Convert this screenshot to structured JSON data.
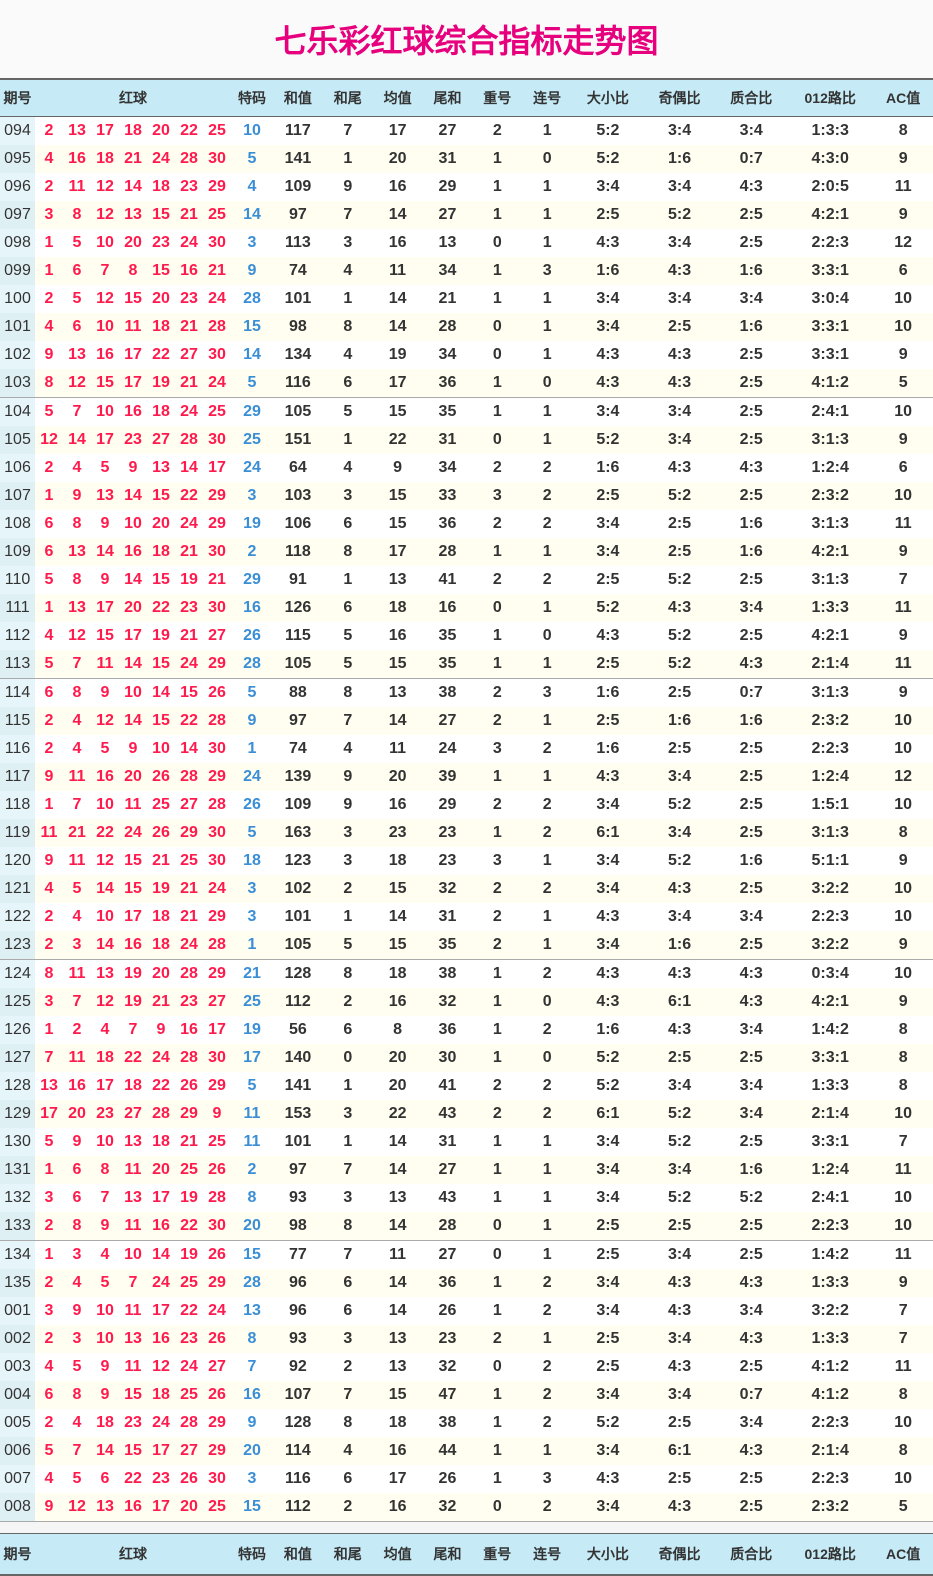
{
  "title": "七乐彩红球综合指标走势图",
  "headers": [
    "期号",
    "红球",
    "特码",
    "和值",
    "和尾",
    "均值",
    "尾和",
    "重号",
    "连号",
    "大小比",
    "奇偶比",
    "质合比",
    "012路比",
    "AC值"
  ],
  "chart_data": {
    "type": "table",
    "columns": [
      "issue",
      "r1",
      "r2",
      "r3",
      "r4",
      "r5",
      "r6",
      "r7",
      "bonus",
      "sum",
      "sumTail",
      "avg",
      "tailSum",
      "repeat",
      "consec",
      "sizeRatio",
      "parityRatio",
      "primeRatio",
      "route012",
      "ac"
    ],
    "rows": [
      [
        "094",
        2,
        13,
        17,
        18,
        20,
        22,
        25,
        10,
        117,
        7,
        17,
        27,
        2,
        1,
        "5:2",
        "3:4",
        "3:4",
        "1:3:3",
        8
      ],
      [
        "095",
        4,
        16,
        18,
        21,
        24,
        28,
        30,
        5,
        141,
        1,
        20,
        31,
        1,
        0,
        "5:2",
        "1:6",
        "0:7",
        "4:3:0",
        9
      ],
      [
        "096",
        2,
        11,
        12,
        14,
        18,
        23,
        29,
        4,
        109,
        9,
        16,
        29,
        1,
        1,
        "3:4",
        "3:4",
        "4:3",
        "2:0:5",
        11
      ],
      [
        "097",
        3,
        8,
        12,
        13,
        15,
        21,
        25,
        14,
        97,
        7,
        14,
        27,
        1,
        1,
        "2:5",
        "5:2",
        "2:5",
        "4:2:1",
        9
      ],
      [
        "098",
        1,
        5,
        10,
        20,
        23,
        24,
        30,
        3,
        113,
        3,
        16,
        13,
        0,
        1,
        "4:3",
        "3:4",
        "2:5",
        "2:2:3",
        12
      ],
      [
        "099",
        1,
        6,
        7,
        8,
        15,
        16,
        21,
        9,
        74,
        4,
        11,
        34,
        1,
        3,
        "1:6",
        "4:3",
        "1:6",
        "3:3:1",
        6
      ],
      [
        "100",
        2,
        5,
        12,
        15,
        20,
        23,
        24,
        28,
        101,
        1,
        14,
        21,
        1,
        1,
        "3:4",
        "3:4",
        "3:4",
        "3:0:4",
        10
      ],
      [
        "101",
        4,
        6,
        10,
        11,
        18,
        21,
        28,
        15,
        98,
        8,
        14,
        28,
        0,
        1,
        "3:4",
        "2:5",
        "1:6",
        "3:3:1",
        10
      ],
      [
        "102",
        9,
        13,
        16,
        17,
        22,
        27,
        30,
        14,
        134,
        4,
        19,
        34,
        0,
        1,
        "4:3",
        "4:3",
        "2:5",
        "3:3:1",
        9
      ],
      [
        "103",
        8,
        12,
        15,
        17,
        19,
        21,
        24,
        5,
        116,
        6,
        17,
        36,
        1,
        0,
        "4:3",
        "4:3",
        "2:5",
        "4:1:2",
        5
      ],
      [
        "104",
        5,
        7,
        10,
        16,
        18,
        24,
        25,
        29,
        105,
        5,
        15,
        35,
        1,
        1,
        "3:4",
        "3:4",
        "2:5",
        "2:4:1",
        10
      ],
      [
        "105",
        12,
        14,
        17,
        23,
        27,
        28,
        30,
        25,
        151,
        1,
        22,
        31,
        0,
        1,
        "5:2",
        "3:4",
        "2:5",
        "3:1:3",
        9
      ],
      [
        "106",
        2,
        4,
        5,
        9,
        13,
        14,
        17,
        24,
        64,
        4,
        9,
        34,
        2,
        2,
        "1:6",
        "4:3",
        "4:3",
        "1:2:4",
        6
      ],
      [
        "107",
        1,
        9,
        13,
        14,
        15,
        22,
        29,
        3,
        103,
        3,
        15,
        33,
        3,
        2,
        "2:5",
        "5:2",
        "2:5",
        "2:3:2",
        10
      ],
      [
        "108",
        6,
        8,
        9,
        10,
        20,
        24,
        29,
        19,
        106,
        6,
        15,
        36,
        2,
        2,
        "3:4",
        "2:5",
        "1:6",
        "3:1:3",
        11
      ],
      [
        "109",
        6,
        13,
        14,
        16,
        18,
        21,
        30,
        2,
        118,
        8,
        17,
        28,
        1,
        1,
        "3:4",
        "2:5",
        "1:6",
        "4:2:1",
        9
      ],
      [
        "110",
        5,
        8,
        9,
        14,
        15,
        19,
        21,
        29,
        91,
        1,
        13,
        41,
        2,
        2,
        "2:5",
        "5:2",
        "2:5",
        "3:1:3",
        7
      ],
      [
        "111",
        1,
        13,
        17,
        20,
        22,
        23,
        30,
        16,
        126,
        6,
        18,
        16,
        0,
        1,
        "5:2",
        "4:3",
        "3:4",
        "1:3:3",
        11
      ],
      [
        "112",
        4,
        12,
        15,
        17,
        19,
        21,
        27,
        26,
        115,
        5,
        16,
        35,
        1,
        0,
        "4:3",
        "5:2",
        "2:5",
        "4:2:1",
        9
      ],
      [
        "113",
        5,
        7,
        11,
        14,
        15,
        24,
        29,
        28,
        105,
        5,
        15,
        35,
        1,
        1,
        "2:5",
        "5:2",
        "4:3",
        "2:1:4",
        11
      ],
      [
        "114",
        6,
        8,
        9,
        10,
        14,
        15,
        26,
        5,
        88,
        8,
        13,
        38,
        2,
        3,
        "1:6",
        "2:5",
        "0:7",
        "3:1:3",
        9
      ],
      [
        "115",
        2,
        4,
        12,
        14,
        15,
        22,
        28,
        9,
        97,
        7,
        14,
        27,
        2,
        1,
        "2:5",
        "1:6",
        "1:6",
        "2:3:2",
        10
      ],
      [
        "116",
        2,
        4,
        5,
        9,
        10,
        14,
        30,
        1,
        74,
        4,
        11,
        24,
        3,
        2,
        "1:6",
        "2:5",
        "2:5",
        "2:2:3",
        10
      ],
      [
        "117",
        9,
        11,
        16,
        20,
        26,
        28,
        29,
        24,
        139,
        9,
        20,
        39,
        1,
        1,
        "4:3",
        "3:4",
        "2:5",
        "1:2:4",
        12
      ],
      [
        "118",
        1,
        7,
        10,
        11,
        25,
        27,
        28,
        26,
        109,
        9,
        16,
        29,
        2,
        2,
        "3:4",
        "5:2",
        "2:5",
        "1:5:1",
        10
      ],
      [
        "119",
        11,
        21,
        22,
        24,
        26,
        29,
        30,
        5,
        163,
        3,
        23,
        23,
        1,
        2,
        "6:1",
        "3:4",
        "2:5",
        "3:1:3",
        8
      ],
      [
        "120",
        9,
        11,
        12,
        15,
        21,
        25,
        30,
        18,
        123,
        3,
        18,
        23,
        3,
        1,
        "3:4",
        "5:2",
        "1:6",
        "5:1:1",
        9
      ],
      [
        "121",
        4,
        5,
        14,
        15,
        19,
        21,
        24,
        3,
        102,
        2,
        15,
        32,
        2,
        2,
        "3:4",
        "4:3",
        "2:5",
        "3:2:2",
        10
      ],
      [
        "122",
        2,
        4,
        10,
        17,
        18,
        21,
        29,
        3,
        101,
        1,
        14,
        31,
        2,
        1,
        "4:3",
        "3:4",
        "3:4",
        "2:2:3",
        10
      ],
      [
        "123",
        2,
        3,
        14,
        16,
        18,
        24,
        28,
        1,
        105,
        5,
        15,
        35,
        2,
        1,
        "3:4",
        "1:6",
        "2:5",
        "3:2:2",
        9
      ],
      [
        "124",
        8,
        11,
        13,
        19,
        20,
        28,
        29,
        21,
        128,
        8,
        18,
        38,
        1,
        2,
        "4:3",
        "4:3",
        "4:3",
        "0:3:4",
        10
      ],
      [
        "125",
        3,
        7,
        12,
        19,
        21,
        23,
        27,
        25,
        112,
        2,
        16,
        32,
        1,
        0,
        "4:3",
        "6:1",
        "4:3",
        "4:2:1",
        9
      ],
      [
        "126",
        1,
        2,
        4,
        7,
        9,
        16,
        17,
        19,
        56,
        6,
        8,
        36,
        1,
        2,
        "1:6",
        "4:3",
        "3:4",
        "1:4:2",
        8
      ],
      [
        "127",
        7,
        11,
        18,
        22,
        24,
        28,
        30,
        17,
        140,
        0,
        20,
        30,
        1,
        0,
        "5:2",
        "2:5",
        "2:5",
        "3:3:1",
        8
      ],
      [
        "128",
        13,
        16,
        17,
        18,
        22,
        26,
        29,
        5,
        141,
        1,
        20,
        41,
        2,
        2,
        "5:2",
        "3:4",
        "3:4",
        "1:3:3",
        8
      ],
      [
        "129",
        17,
        20,
        23,
        27,
        28,
        29,
        9,
        11,
        153,
        3,
        22,
        43,
        2,
        2,
        "6:1",
        "5:2",
        "3:4",
        "2:1:4",
        10
      ],
      [
        "130",
        5,
        9,
        10,
        13,
        18,
        21,
        25,
        11,
        101,
        1,
        14,
        31,
        1,
        1,
        "3:4",
        "5:2",
        "2:5",
        "3:3:1",
        7
      ],
      [
        "131",
        1,
        6,
        8,
        11,
        20,
        25,
        26,
        2,
        97,
        7,
        14,
        27,
        1,
        1,
        "3:4",
        "3:4",
        "1:6",
        "1:2:4",
        11
      ],
      [
        "132",
        3,
        6,
        7,
        13,
        17,
        19,
        28,
        8,
        93,
        3,
        13,
        43,
        1,
        1,
        "3:4",
        "5:2",
        "5:2",
        "2:4:1",
        10
      ],
      [
        "133",
        2,
        8,
        9,
        11,
        16,
        22,
        30,
        20,
        98,
        8,
        14,
        28,
        0,
        1,
        "2:5",
        "2:5",
        "2:5",
        "2:2:3",
        10
      ],
      [
        "134",
        1,
        3,
        4,
        10,
        14,
        19,
        26,
        15,
        77,
        7,
        11,
        27,
        0,
        1,
        "2:5",
        "3:4",
        "2:5",
        "1:4:2",
        11
      ],
      [
        "135",
        2,
        4,
        5,
        7,
        24,
        25,
        29,
        28,
        96,
        6,
        14,
        36,
        1,
        2,
        "3:4",
        "4:3",
        "4:3",
        "1:3:3",
        9
      ],
      [
        "001",
        3,
        9,
        10,
        11,
        17,
        22,
        24,
        13,
        96,
        6,
        14,
        26,
        1,
        2,
        "3:4",
        "4:3",
        "3:4",
        "3:2:2",
        7
      ],
      [
        "002",
        2,
        3,
        10,
        13,
        16,
        23,
        26,
        8,
        93,
        3,
        13,
        23,
        2,
        1,
        "2:5",
        "3:4",
        "4:3",
        "1:3:3",
        7
      ],
      [
        "003",
        4,
        5,
        9,
        11,
        12,
        24,
        27,
        7,
        92,
        2,
        13,
        32,
        0,
        2,
        "2:5",
        "4:3",
        "2:5",
        "4:1:2",
        11
      ],
      [
        "004",
        6,
        8,
        9,
        15,
        18,
        25,
        26,
        16,
        107,
        7,
        15,
        47,
        1,
        2,
        "3:4",
        "3:4",
        "0:7",
        "4:1:2",
        8
      ],
      [
        "005",
        2,
        4,
        18,
        23,
        24,
        28,
        29,
        9,
        128,
        8,
        18,
        38,
        1,
        2,
        "5:2",
        "2:5",
        "3:4",
        "2:2:3",
        10
      ],
      [
        "006",
        5,
        7,
        14,
        15,
        17,
        27,
        29,
        20,
        114,
        4,
        16,
        44,
        1,
        1,
        "3:4",
        "6:1",
        "4:3",
        "2:1:4",
        8
      ],
      [
        "007",
        4,
        5,
        6,
        22,
        23,
        26,
        30,
        3,
        116,
        6,
        17,
        26,
        1,
        3,
        "4:3",
        "2:5",
        "2:5",
        "2:2:3",
        10
      ],
      [
        "008",
        9,
        12,
        13,
        16,
        17,
        20,
        25,
        15,
        112,
        2,
        16,
        32,
        0,
        2,
        "3:4",
        "4:3",
        "2:5",
        "2:3:2",
        5
      ]
    ]
  }
}
